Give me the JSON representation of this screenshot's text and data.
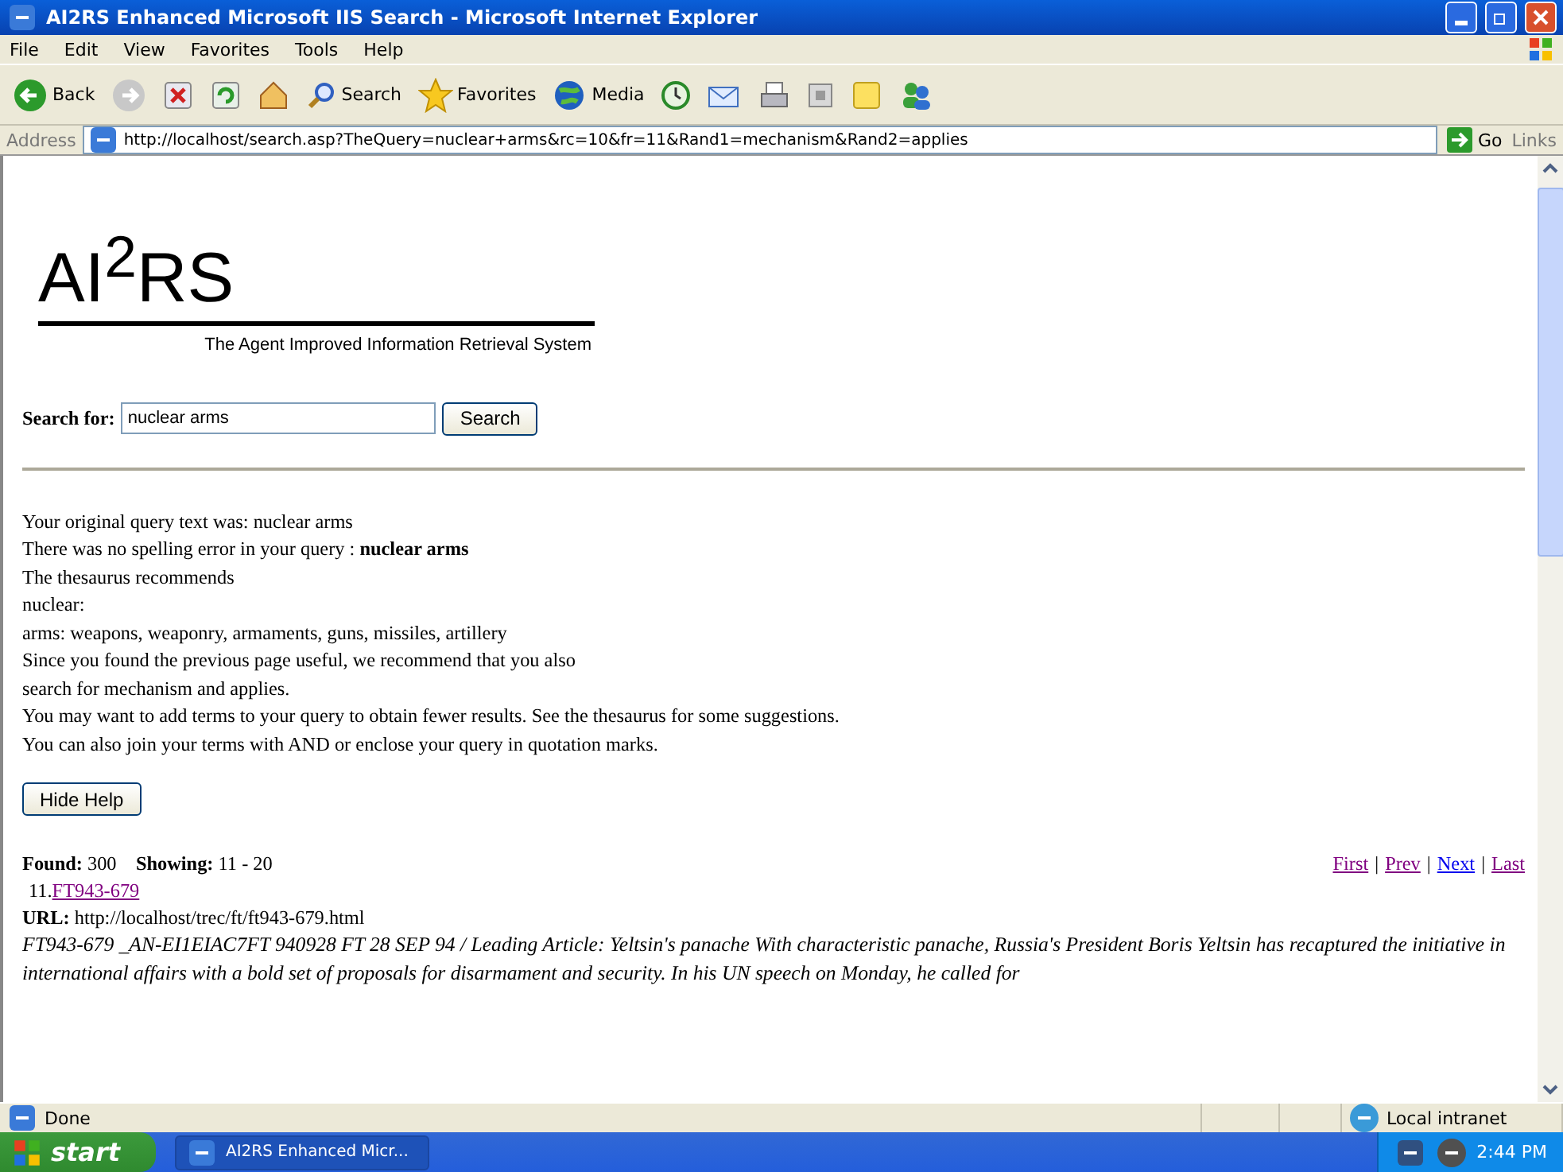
{
  "window": {
    "title": "AI2RS Enhanced Microsoft IIS Search - Microsoft Internet Explorer"
  },
  "menu": [
    "File",
    "Edit",
    "View",
    "Favorites",
    "Tools",
    "Help"
  ],
  "toolbar": [
    {
      "kind": "back",
      "label": "Back"
    },
    {
      "kind": "forward"
    },
    {
      "kind": "stop"
    },
    {
      "kind": "refresh"
    },
    {
      "kind": "home"
    },
    {
      "kind": "search",
      "label": "Search"
    },
    {
      "kind": "favorites",
      "label": "Favorites"
    },
    {
      "kind": "media",
      "label": "Media"
    },
    {
      "kind": "history"
    },
    {
      "kind": "mail"
    },
    {
      "kind": "print"
    },
    {
      "kind": "edit"
    },
    {
      "kind": "note"
    },
    {
      "kind": "messenger"
    }
  ],
  "address": {
    "label": "Address",
    "value": "http://localhost/search.asp?TheQuery=nuclear+arms&rc=10&fr=11&Rand1=mechanism&Rand2=applies",
    "go": "Go",
    "links": "Links"
  },
  "page": {
    "logo": "AI$^{2}$RS",
    "tagline": "The Agent Improved Information Retrieval System",
    "search_label": "Search for:",
    "search_value": "nuclear arms",
    "search_button": "Search",
    "help_lines": [
      "Your original query text was: nuclear arms",
      "There was no spelling error in your query : **nuclear arms**",
      "The thesaurus recommends",
      "nuclear:",
      "arms: weapons, weaponry, armaments, guns, missiles, artillery",
      "Since you found the previous page useful, we recommend that you also",
      "search for mechanism and applies.",
      "You may want to add terms to your query to obtain fewer results. See the thesaurus for some suggestions.",
      "You can also join your terms with AND or enclose your query in quotation marks."
    ],
    "hide_help": "Hide Help",
    "found_label": "Found:",
    "found": "300",
    "showing_label": "Showing:",
    "showing": "11 - 20",
    "pager_separator": "|",
    "pager": [
      {
        "label": "First",
        "visited": true
      },
      {
        "label": "Prev",
        "visited": true
      },
      {
        "label": "Next",
        "visited": false
      },
      {
        "label": "Last",
        "visited": true
      }
    ],
    "results": [
      {
        "number": "11.",
        "title": "FT943-679",
        "visited": true,
        "url_label": "URL:",
        "url": "http://localhost/trec/ft/ft943-679.html",
        "snippet": "FT943-679 _AN-EI1EIAC7FT 940928 FT 28 SEP 94 / Leading Article: Yeltsin's panache With characteristic panache, Russia's President Boris Yeltsin has recaptured the initiative in international affairs with a bold set of proposals for disarmament and security. In his UN speech on Monday, he called for"
      }
    ]
  },
  "status_bar": {
    "text": "Done",
    "zone": "Local intranet"
  },
  "taskbar": {
    "start": "start",
    "task": "AI2RS Enhanced Micr...",
    "time": "2:44 PM"
  }
}
